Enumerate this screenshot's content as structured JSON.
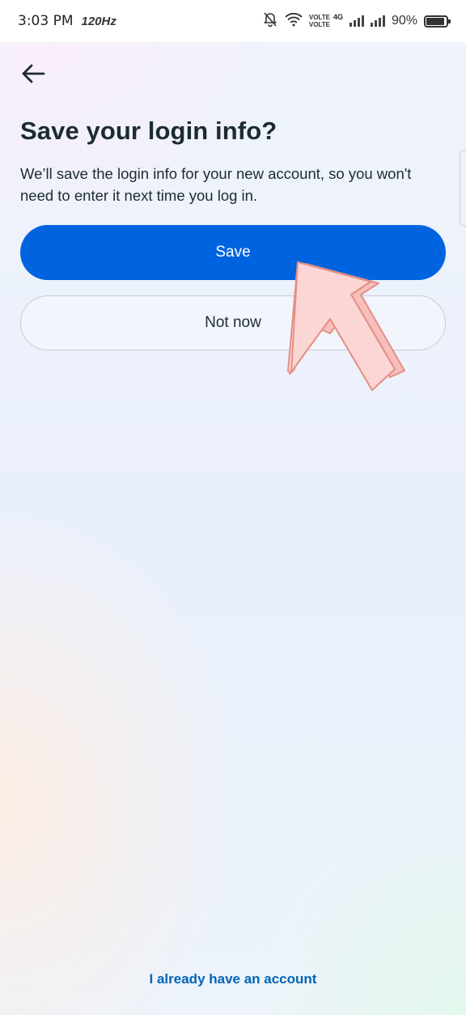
{
  "status_bar": {
    "time": "3:03 PM",
    "refresh_rate": "120Hz",
    "volte_1": "VOLTE",
    "volte_2": "VOLTE",
    "network": "4G",
    "battery_percent": "90%",
    "battery_level": 0.9
  },
  "page": {
    "title": "Save your login info?",
    "subtitle": "We’ll save the login info for your new account, so you won't need to enter it next time you log in.",
    "save_label": "Save",
    "not_now_label": "Not now",
    "have_account_link": "I already have an account"
  },
  "colors": {
    "primary": "#0064e0",
    "link": "#0064b7",
    "text": "#1c2b33",
    "pointer_fill": "#fcd6d4",
    "pointer_stroke": "#e58f86"
  },
  "icons": {
    "back": "back-arrow-icon",
    "pointer": "pointing-arrow-icon"
  }
}
